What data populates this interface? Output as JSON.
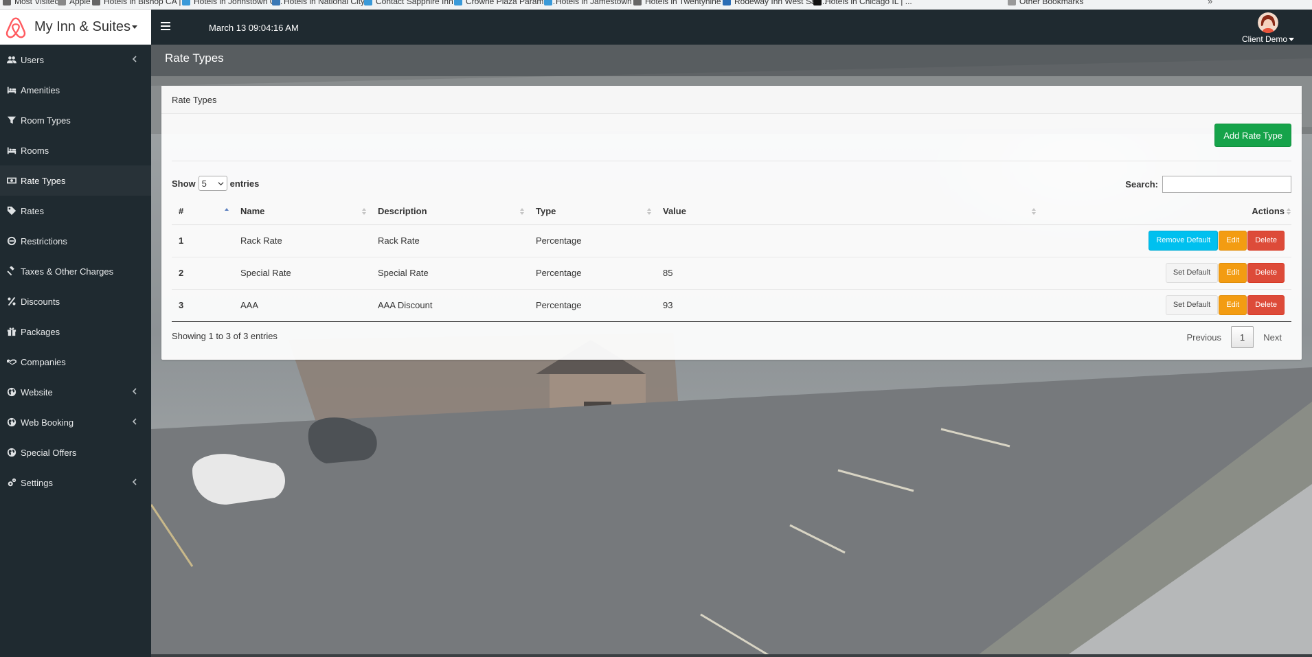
{
  "bookmarks": [
    {
      "label": "Most Visited",
      "color": "#666666"
    },
    {
      "label": "Apple",
      "color": "#888888"
    },
    {
      "label": "Hotels in Bishop CA | ...",
      "color": "#666666"
    },
    {
      "label": "Hotels in Johnstown C...",
      "color": "#3a9ad9"
    },
    {
      "label": "Hotels in National City...",
      "color": "#3a78b5"
    },
    {
      "label": "Contact Sapphire Inn ...",
      "color": "#3a9ad9"
    },
    {
      "label": "Crowne Plaza Paramu...",
      "color": "#3a9ad9"
    },
    {
      "label": "Hotels in Jamestown ...",
      "color": "#3a9ad9"
    },
    {
      "label": "Hotels in Twentynine ...",
      "color": "#666666"
    },
    {
      "label": "Rodeway Inn West Sac...",
      "color": "#2a6db5"
    },
    {
      "label": "Hotels in Chicago IL | ...",
      "color": "#111111"
    },
    {
      "label": "Other Bookmarks",
      "color": "#999999"
    }
  ],
  "brand": {
    "name": "My Inn & Suites",
    "logo_color": "#ff5a5f"
  },
  "topbar": {
    "datetime": "March 13  09:04:16 AM",
    "user_name": "Client Demo"
  },
  "sidebar": [
    {
      "label": "Users",
      "icon": "users-icon",
      "expandable": true
    },
    {
      "label": "Amenities",
      "icon": "bed-icon",
      "expandable": false
    },
    {
      "label": "Room Types",
      "icon": "filter-icon",
      "expandable": false
    },
    {
      "label": "Rooms",
      "icon": "bed-icon",
      "expandable": false
    },
    {
      "label": "Rate Types",
      "icon": "money-icon",
      "expandable": false,
      "active": true
    },
    {
      "label": "Rates",
      "icon": "tag-icon",
      "expandable": false
    },
    {
      "label": "Restrictions",
      "icon": "ban-icon",
      "expandable": false
    },
    {
      "label": "Taxes & Other Charges",
      "icon": "gavel-icon",
      "expandable": false
    },
    {
      "label": "Discounts",
      "icon": "percent-icon",
      "expandable": false
    },
    {
      "label": "Packages",
      "icon": "gift-icon",
      "expandable": false
    },
    {
      "label": "Companies",
      "icon": "handshake-icon",
      "expandable": false
    },
    {
      "label": "Website",
      "icon": "globe-icon",
      "expandable": true
    },
    {
      "label": "Web Booking",
      "icon": "globe-icon",
      "expandable": true
    },
    {
      "label": "Special Offers",
      "icon": "globe-icon",
      "expandable": false
    },
    {
      "label": "Settings",
      "icon": "cogs-icon",
      "expandable": true
    }
  ],
  "page": {
    "title": "Rate Types"
  },
  "panel": {
    "title": "Rate Types",
    "add_label": "Add Rate Type",
    "show_label": "Show",
    "entries_label": "entries",
    "page_length": "5",
    "search_label": "Search:",
    "search_value": "",
    "info": "Showing 1 to 3 of 3 entries",
    "prev_label": "Previous",
    "current_page": "1",
    "next_label": "Next"
  },
  "table": {
    "columns": [
      "#",
      "Name",
      "Description",
      "Type",
      "Value",
      "Actions"
    ],
    "rows": [
      {
        "num": "1",
        "name": "Rack Rate",
        "description": "Rack Rate",
        "type": "Percentage",
        "value": "",
        "default_action": "Remove Default",
        "is_default": true
      },
      {
        "num": "2",
        "name": "Special Rate",
        "description": "Special Rate",
        "type": "Percentage",
        "value": "85",
        "default_action": "Set Default",
        "is_default": false
      },
      {
        "num": "3",
        "name": "AAA",
        "description": "AAA Discount",
        "type": "Percentage",
        "value": "93",
        "default_action": "Set Default",
        "is_default": false
      }
    ],
    "edit_label": "Edit",
    "delete_label": "Delete"
  },
  "colors": {
    "sidebar_bg": "#1f2a30",
    "success": "#16a34a",
    "info": "#00c0ef",
    "warning": "#f39c12",
    "danger": "#dd4b39"
  }
}
